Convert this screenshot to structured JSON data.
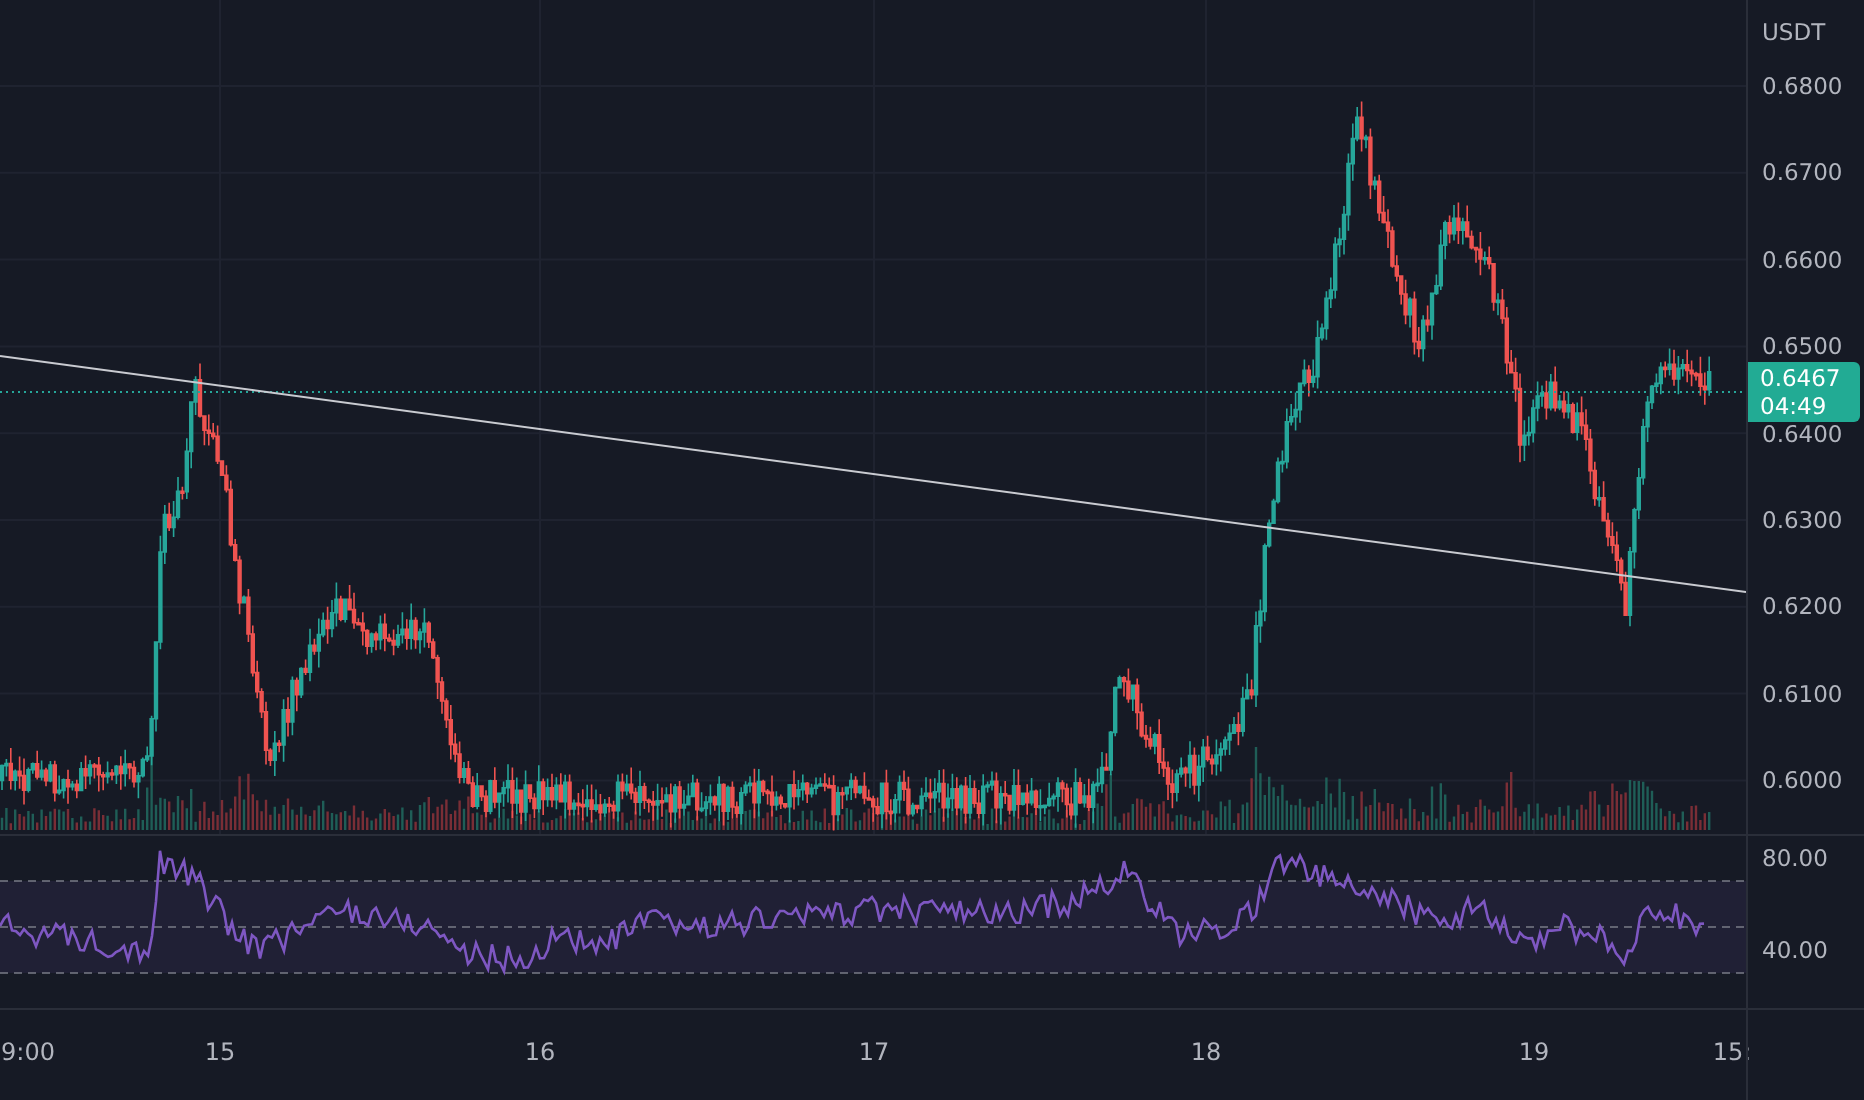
{
  "price_axis": {
    "currency": "USDT",
    "ticks": [
      "0.6800",
      "0.6700",
      "0.6600",
      "0.6500",
      "0.6400",
      "0.6300",
      "0.6200",
      "0.6100",
      "0.6000"
    ]
  },
  "last_price": {
    "price": "0.6467",
    "countdown": "04:49"
  },
  "rsi_axis": {
    "ticks": [
      "80.00",
      "40.00"
    ]
  },
  "time_axis": {
    "labels": [
      "9:00",
      "15",
      "16",
      "17",
      "18",
      "19",
      "15:"
    ]
  }
}
